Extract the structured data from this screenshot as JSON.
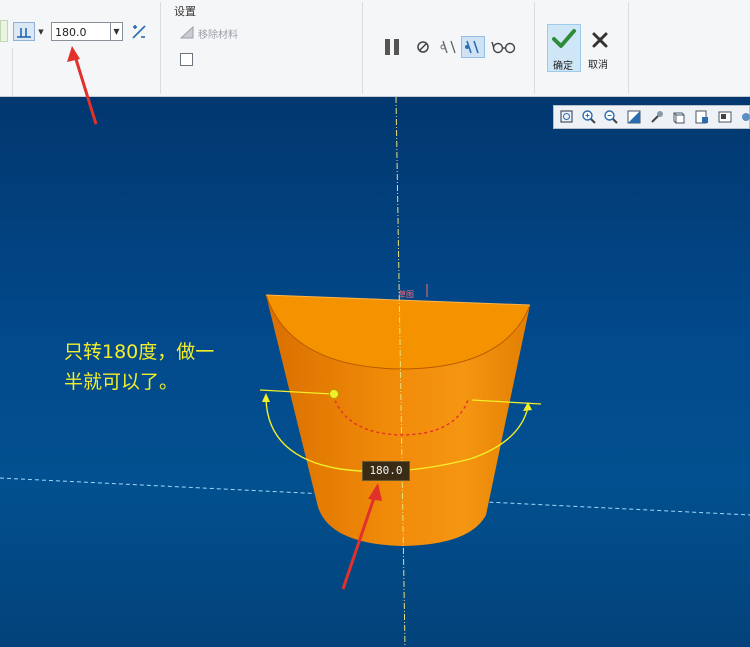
{
  "ribbon": {
    "angle_value": "180.0",
    "settings_group_label": "设置",
    "remove_material_label": "移除材料",
    "ok_label": "确定",
    "cancel_label": "取消"
  },
  "viewport": {
    "annotation_line1": "只转180度，做一",
    "annotation_line2": "半就可以了。",
    "dimension_value": "180.0",
    "sketch_tag": "草图"
  },
  "colors": {
    "viewport_bg": "#024a8c",
    "part_orange": "#f28c00",
    "annotation_yellow": "#f3ee2a",
    "arrow_red": "#e0312b",
    "ok_button_bg": "#cfe6f7"
  },
  "icons": [
    "angle-side-icon",
    "dropdown-arrow-icon",
    "flip-direction-icon",
    "remove-material-icon",
    "pause-icon",
    "no-preview-icon",
    "preview-icon",
    "verify-icon",
    "glasses-icon",
    "checkmark-icon",
    "close-icon",
    "refit-icon",
    "zoom-in-icon",
    "zoom-out-icon",
    "repaint-icon",
    "display-style-icon",
    "named-views-icon",
    "view-manager-icon",
    "datum-display-icon"
  ]
}
